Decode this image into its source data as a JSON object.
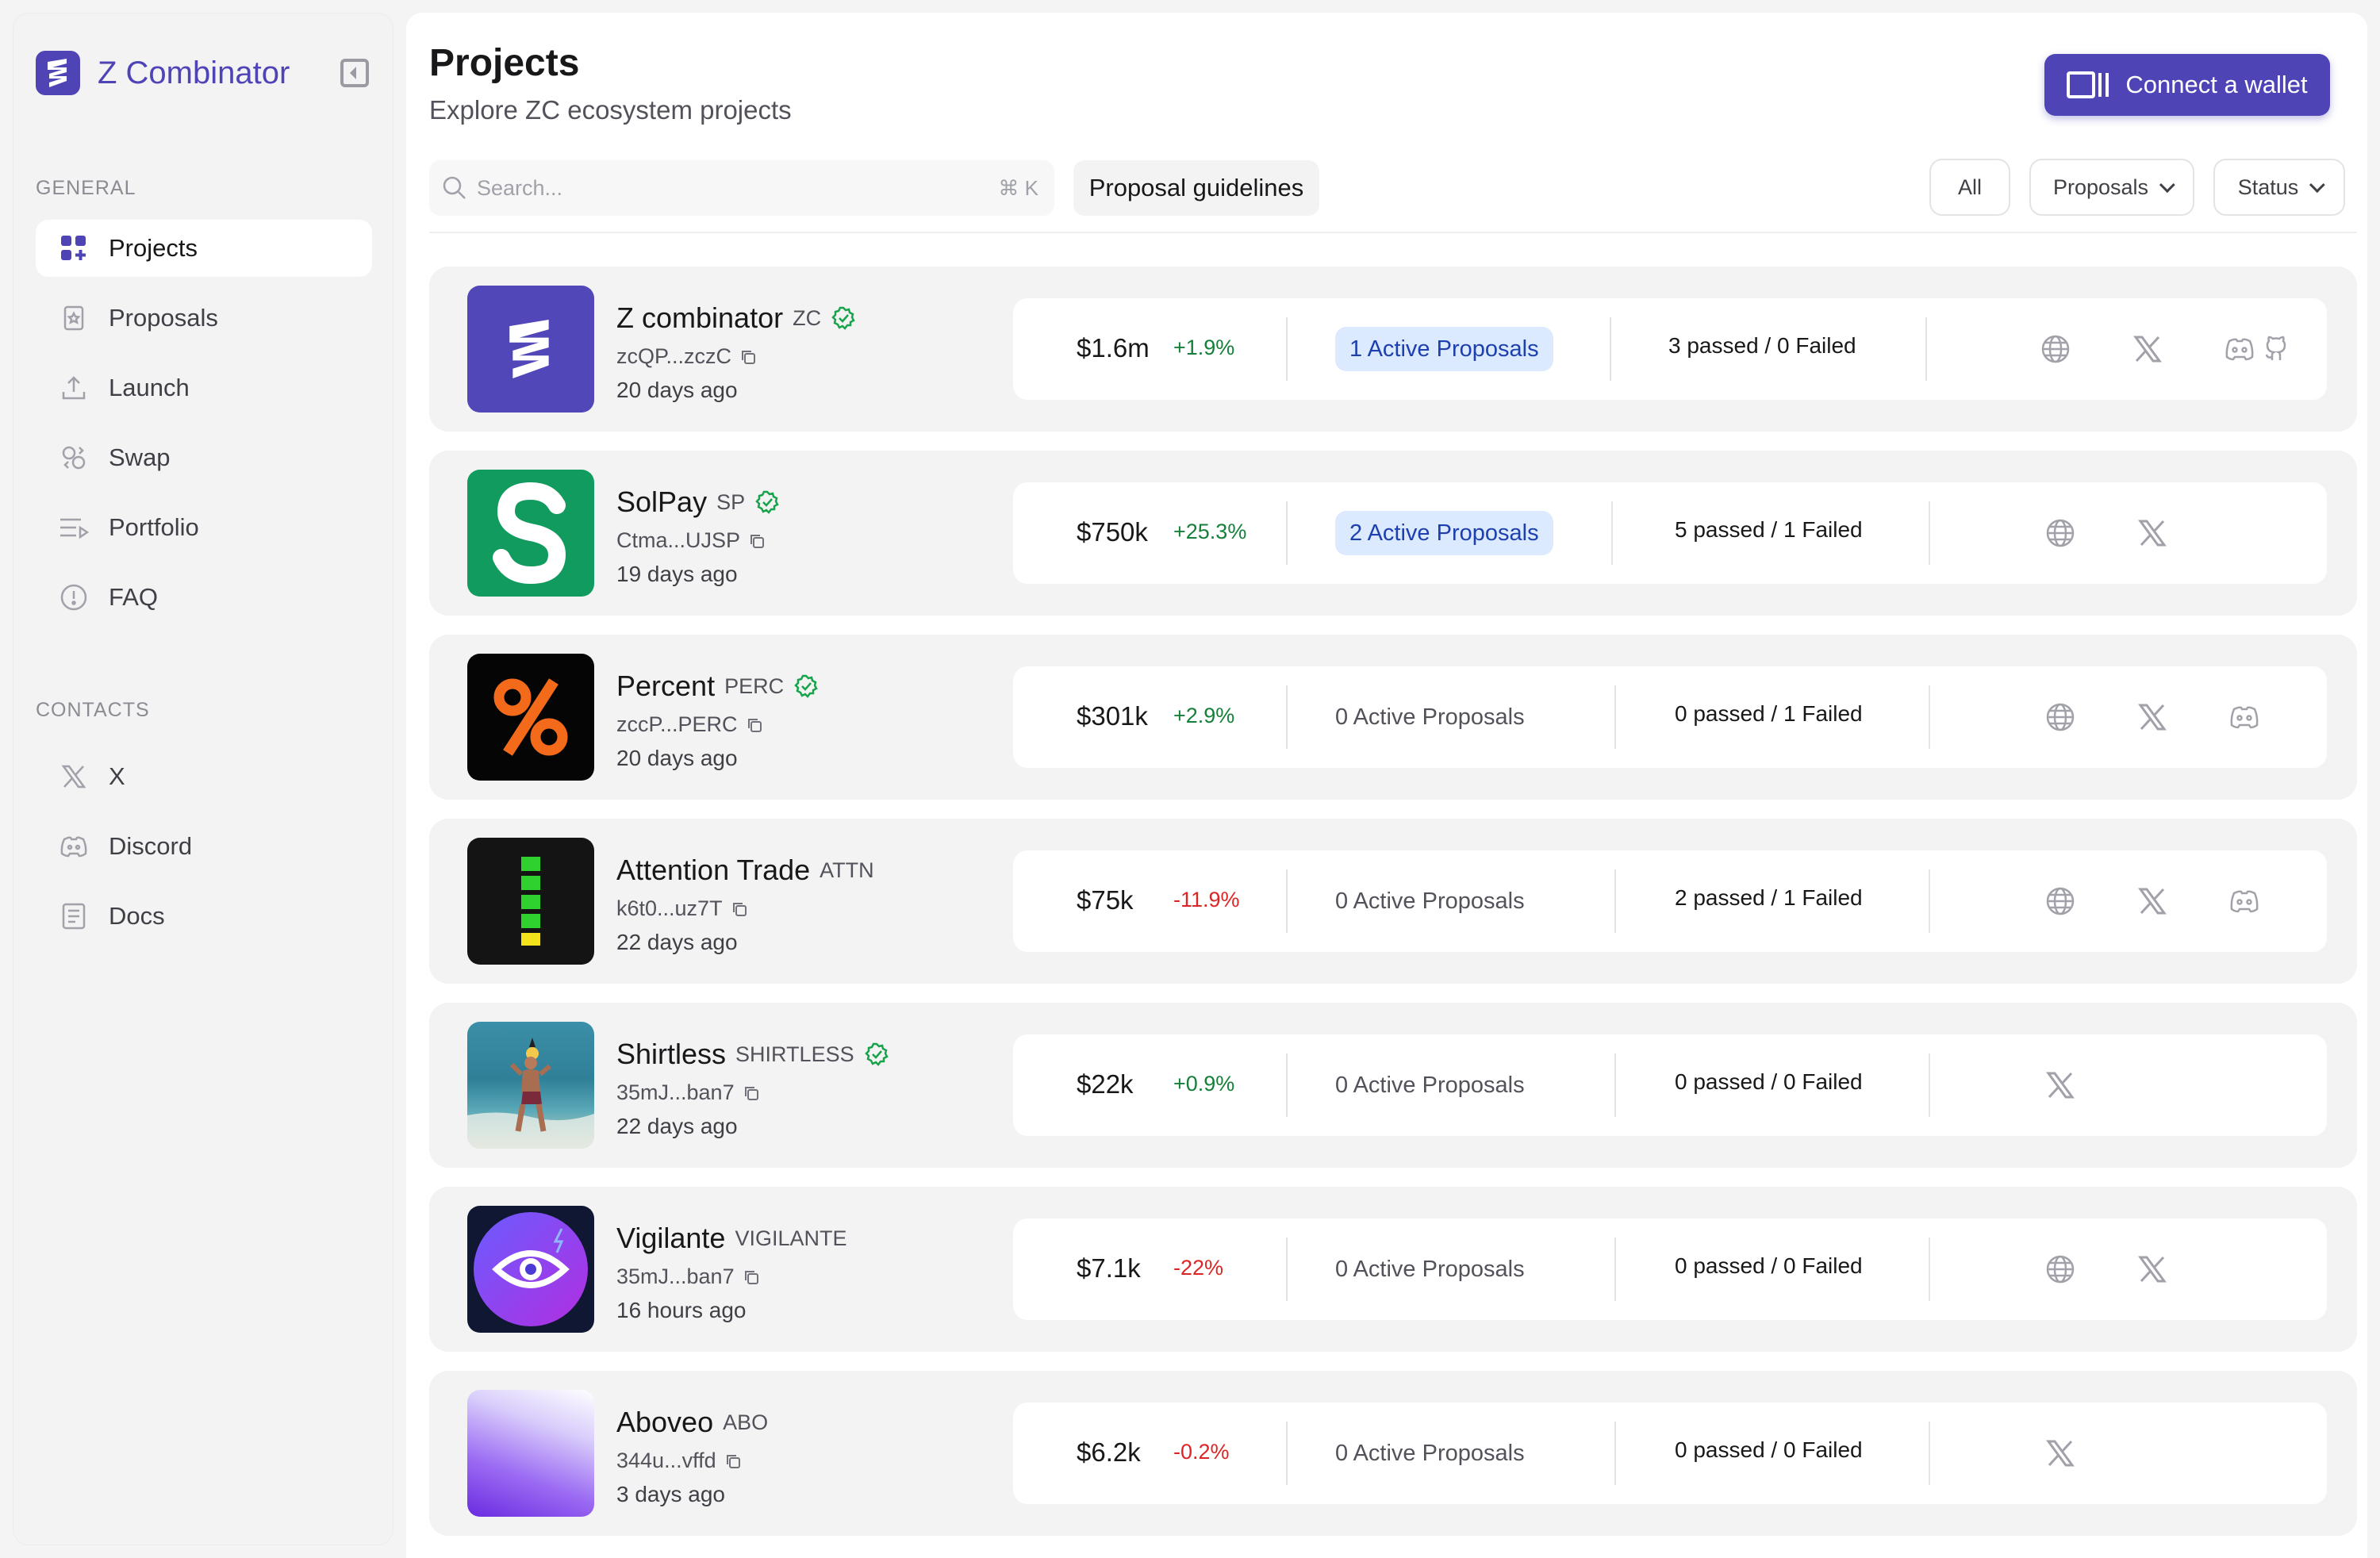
{
  "app": {
    "name": "Z Combinator",
    "brand_color": "#4e44b6"
  },
  "sidebar": {
    "general_label": "GENERAL",
    "contacts_label": "CONTACTS",
    "general_items": [
      {
        "label": "Projects",
        "icon": "grid-icon",
        "active": true
      },
      {
        "label": "Proposals",
        "icon": "proposal-icon",
        "active": false
      },
      {
        "label": "Launch",
        "icon": "upload-icon",
        "active": false
      },
      {
        "label": "Swap",
        "icon": "swap-icon",
        "active": false
      },
      {
        "label": "Portfolio",
        "icon": "portfolio-icon",
        "active": false
      },
      {
        "label": "FAQ",
        "icon": "info-icon",
        "active": false
      }
    ],
    "contact_items": [
      {
        "label": "X",
        "icon": "x-icon"
      },
      {
        "label": "Discord",
        "icon": "discord-icon"
      },
      {
        "label": "Docs",
        "icon": "docs-icon"
      }
    ]
  },
  "header": {
    "title": "Projects",
    "subtitle": "Explore ZC ecosystem projects",
    "connect_label": "Connect a wallet"
  },
  "toolbar": {
    "search_placeholder": "Search...",
    "search_shortcut": "⌘ K",
    "guidelines_label": "Proposal guidelines",
    "filter_all": "All",
    "filter_proposals": "Proposals",
    "filter_status": "Status"
  },
  "projects": [
    {
      "name": "Z combinator",
      "ticker": "ZC",
      "verified": true,
      "address": "zcQP...zczC",
      "age": "20 days ago",
      "price": "$1.6m",
      "change": "+1.9%",
      "change_dir": "up",
      "proposals": "1 Active Proposals",
      "proposals_active": true,
      "passed": "3 passed",
      "failed": "0 Failed",
      "socials": [
        "globe-icon",
        "x-icon",
        "discord-icon",
        "github-icon"
      ],
      "logo": "zc"
    },
    {
      "name": "SolPay",
      "ticker": "SP",
      "verified": true,
      "address": "Ctma...UJSP",
      "age": "19 days ago",
      "price": "$750k",
      "change": "+25.3%",
      "change_dir": "up",
      "proposals": "2 Active Proposals",
      "proposals_active": true,
      "passed": "5 passed",
      "failed": "1 Failed",
      "socials": [
        "globe-icon",
        "x-icon"
      ],
      "logo": "solpay"
    },
    {
      "name": "Percent",
      "ticker": "PERC",
      "verified": true,
      "address": "zccP...PERC",
      "age": "20 days ago",
      "price": "$301k",
      "change": "+2.9%",
      "change_dir": "up",
      "proposals": "0 Active Proposals",
      "proposals_active": false,
      "passed": "0 passed",
      "failed": "1 Failed",
      "socials": [
        "globe-icon",
        "x-icon",
        "discord-icon"
      ],
      "logo": "percent"
    },
    {
      "name": "Attention Trade",
      "ticker": "ATTN",
      "verified": false,
      "address": "k6t0...uz7T",
      "age": "22 days ago",
      "price": "$75k",
      "change": "-11.9%",
      "change_dir": "down",
      "proposals": "0 Active Proposals",
      "proposals_active": false,
      "passed": "2 passed",
      "failed": "1 Failed",
      "socials": [
        "globe-icon",
        "x-icon",
        "discord-icon"
      ],
      "logo": "attn"
    },
    {
      "name": "Shirtless",
      "ticker": "SHIRTLESS",
      "verified": true,
      "address": "35mJ...ban7",
      "age": "22 days ago",
      "price": "$22k",
      "change": "+0.9%",
      "change_dir": "up",
      "proposals": "0 Active Proposals",
      "proposals_active": false,
      "passed": "0 passed",
      "failed": "0 Failed",
      "socials": [
        "x-icon"
      ],
      "logo": "shirtless"
    },
    {
      "name": "Vigilante",
      "ticker": "VIGILANTE",
      "verified": false,
      "address": "35mJ...ban7",
      "age": "16 hours ago",
      "price": "$7.1k",
      "change": "-22%",
      "change_dir": "down",
      "proposals": "0 Active Proposals",
      "proposals_active": false,
      "passed": "0 passed",
      "failed": "0 Failed",
      "socials": [
        "globe-icon",
        "x-icon"
      ],
      "logo": "vigilante"
    },
    {
      "name": "Aboveo",
      "ticker": "ABO",
      "verified": false,
      "address": "344u...vffd",
      "age": "3 days ago",
      "price": "$6.2k",
      "change": "-0.2%",
      "change_dir": "down",
      "proposals": "0 Active Proposals",
      "proposals_active": false,
      "passed": "0 passed",
      "failed": "0 Failed",
      "socials": [
        "x-icon"
      ],
      "logo": "aboveo"
    }
  ]
}
